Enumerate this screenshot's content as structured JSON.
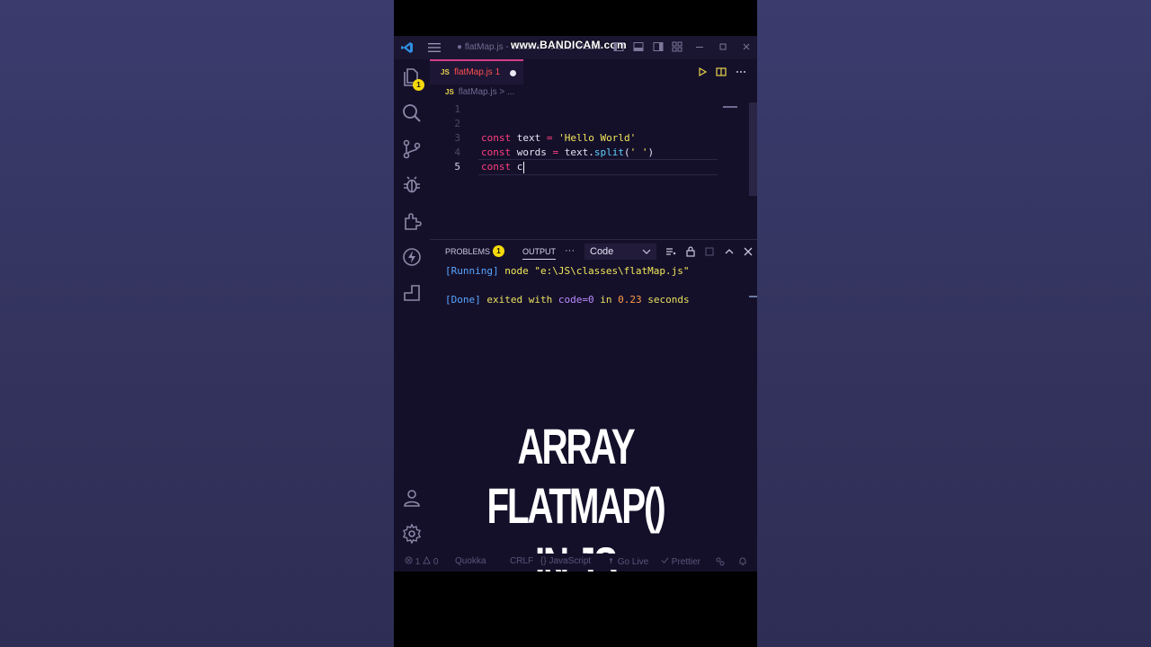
{
  "watermark": "www.BANDICAM.com",
  "titlebar": {
    "title": "● flatMap.js - classes - Visual Studio"
  },
  "activity_bar": {
    "explorer_badge": "1"
  },
  "tab": {
    "lang": "JS",
    "name": "flatMap.js 1"
  },
  "breadcrumb": {
    "lang": "JS",
    "file": "flatMap.js",
    "sep": "> ..."
  },
  "editor": {
    "lines": [
      {
        "num": "1"
      },
      {
        "num": "2"
      },
      {
        "num": "3",
        "kw": "const",
        "name": " text ",
        "op": "=",
        "str": " 'Hello World'"
      },
      {
        "num": "4",
        "kw": "const",
        "name": " words ",
        "op": "=",
        "rest1": " text.",
        "fn": "split",
        "rest2": "(",
        "str": "' '",
        "rest3": ")"
      },
      {
        "num": "5",
        "kw": "const",
        "name": " c"
      }
    ]
  },
  "panel": {
    "problems_label": "PROBLEMS",
    "problems_count": "1",
    "output_label": "OUTPUT",
    "more": "···",
    "select_value": "Code",
    "output": {
      "running_tag": "[Running]",
      "running_cmd": " node \"e:\\JS\\classes\\flatMap.js\"",
      "done_tag": "[Done]",
      "exited": " exited with ",
      "code": "code=0",
      "in": " in ",
      "secs": "0.23",
      "seconds": " seconds"
    }
  },
  "overlay": {
    "line1": "ARRAY",
    "line2": "FLATMAP()",
    "line3": "IN JS"
  },
  "statusbar": {
    "errors": "1",
    "warnings": "0",
    "quokka": "Quokka",
    "eol": "CRLF",
    "lang": "JavaScript",
    "golive": "Go Live",
    "prettier": "Prettier"
  },
  "colors": {
    "editor_bg": "#15102a",
    "keyword": "#ff3f7f",
    "string": "#f1e75a",
    "function": "#5fd1ff",
    "badge": "#f5d90a",
    "tab_error": "#ff4f4f"
  }
}
